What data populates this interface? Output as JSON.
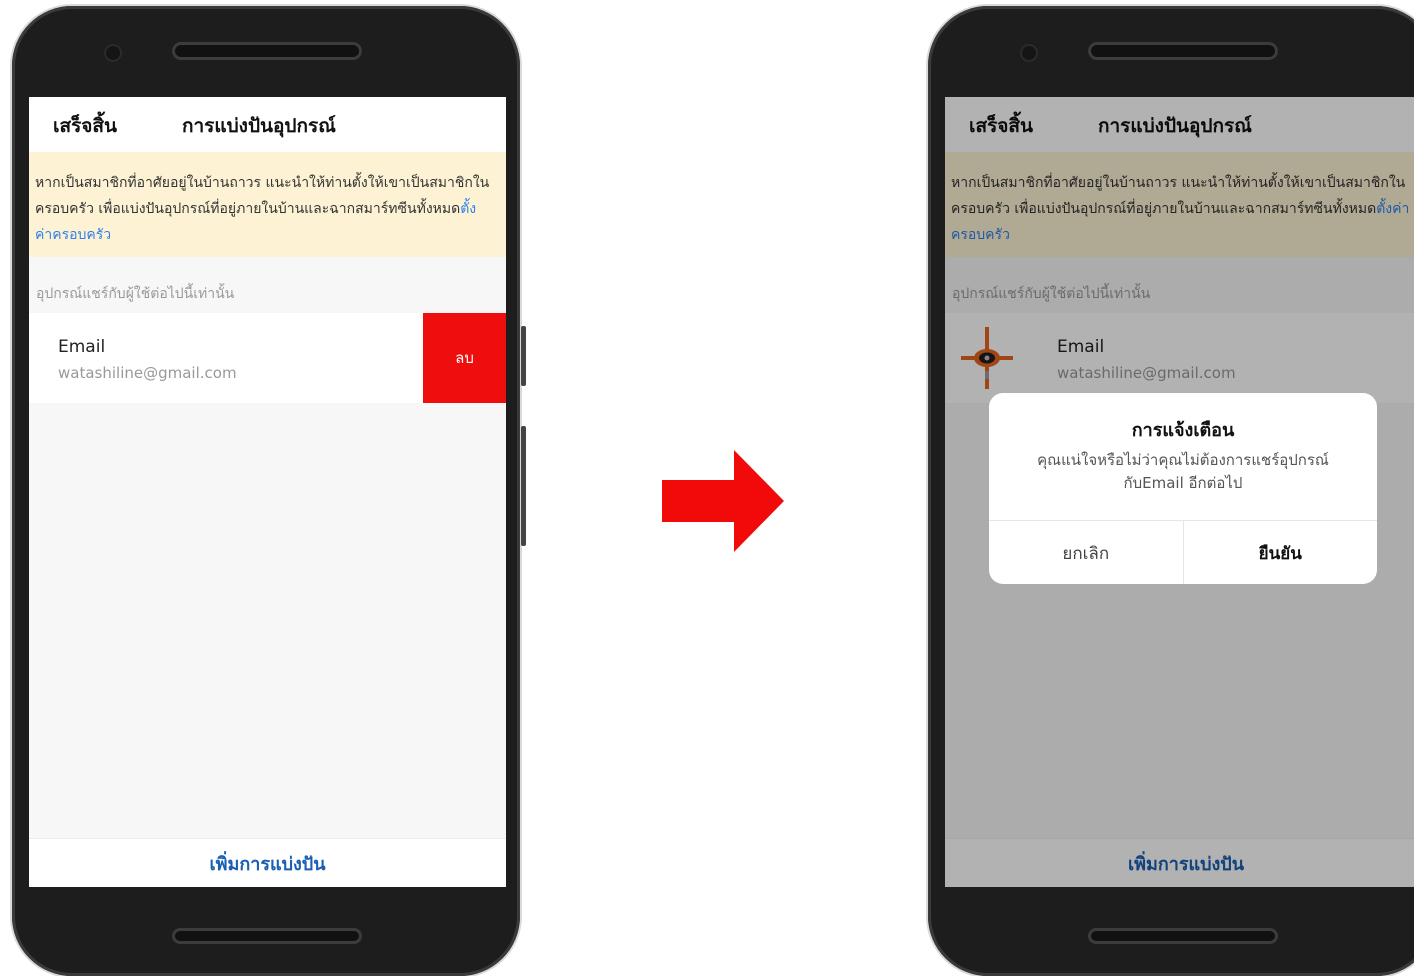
{
  "nav": {
    "done_label": "เสร็จสิ้น",
    "title": "การแบ่งปันอุปกรณ์"
  },
  "notice": {
    "text": "หากเป็นสมาชิกที่อาศัยอยู่ในบ้านถาวร แนะนำให้ท่านตั้งให้เขาเป็นสมาชิกในครอบครัว เพื่อแบ่งปันอุปกรณ์ที่อยู่ภายในบ้านและฉากสมาร์ทซีนทั้งหมด",
    "link_label": "ตั้งค่าครอบครัว"
  },
  "section_label": "อุปกรณ์แชร์กับผู้ใช้ต่อไปนี้เท่านั้น",
  "shared_user": {
    "name": "Email",
    "email": "watashiline@gmail.com"
  },
  "delete_label": "ลบ",
  "add_share_label": "เพิ่มการแบ่งปัน",
  "dialog": {
    "title": "การแจ้งเตือน",
    "message_line1": "คุณแน่ใจหรือไม่ว่าคุณไม่ต้องการแชร์อุปกรณ์",
    "message_line2": "กับEmail อีกต่อไป",
    "cancel_label": "ยกเลิก",
    "confirm_label": "ยืนยัน"
  },
  "icons": {
    "arrow": "right-arrow-icon",
    "avatar": "user-avatar-icon"
  },
  "colors": {
    "delete_red": "#ee0e0e",
    "arrow_red": "#f20a0a",
    "link_blue": "#2f80ed",
    "action_blue": "#1a5fb4",
    "notice_bg": "#fdf3d4",
    "avatar_orange": "#e8641e"
  }
}
